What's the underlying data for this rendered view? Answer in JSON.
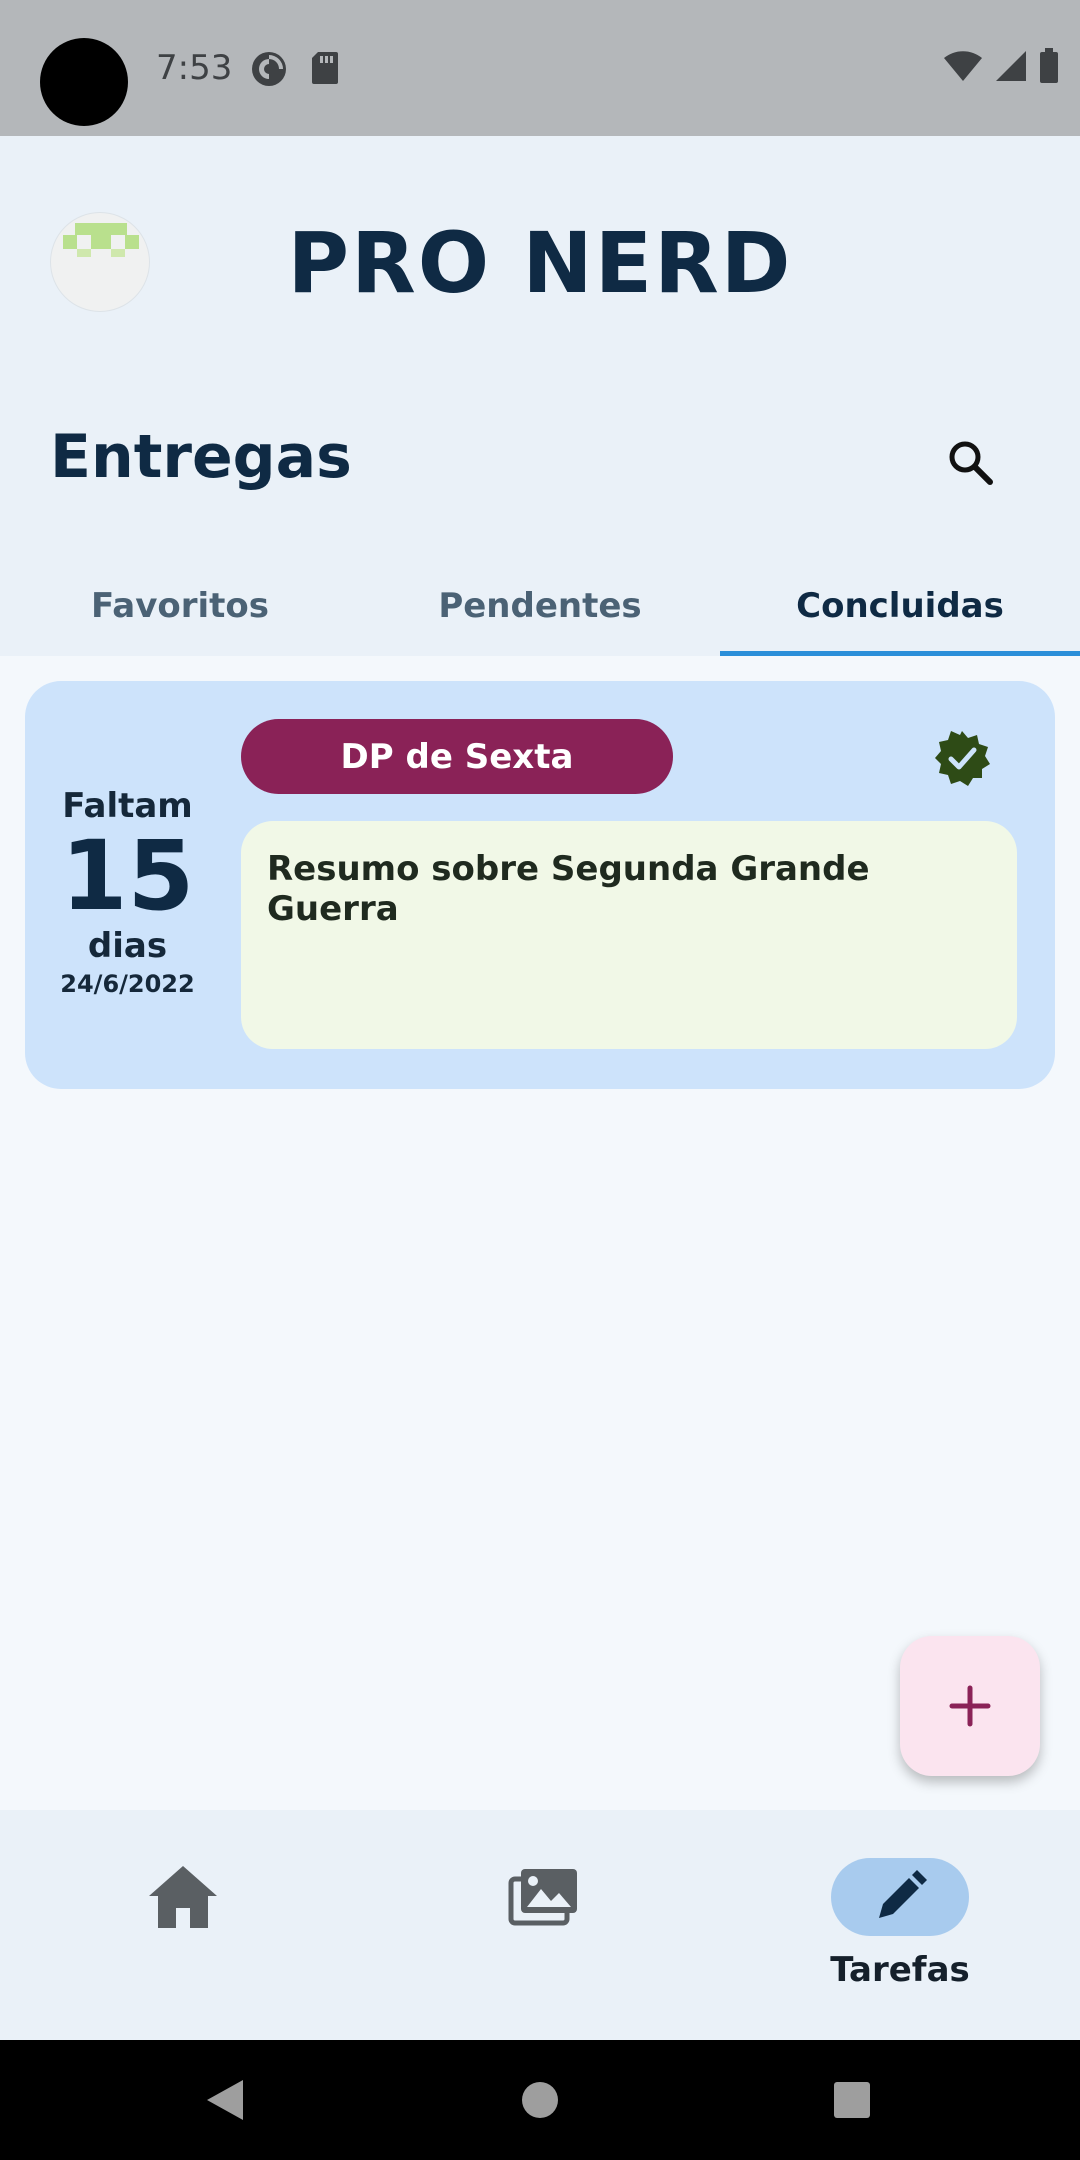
{
  "status_bar": {
    "time": "7:53",
    "left_icons": [
      "pocket-casts-icon",
      "sd-card-icon"
    ],
    "right_icons": [
      "wifi-icon",
      "cell-signal-icon",
      "battery-icon"
    ]
  },
  "header": {
    "app_title": "PRO NERD",
    "avatar_icon": "pixel-avatar-icon"
  },
  "section": {
    "title": "Entregas",
    "search_icon": "search-icon"
  },
  "tabs": [
    {
      "label": "Favoritos",
      "active": false
    },
    {
      "label": "Pendentes",
      "active": false
    },
    {
      "label": "Concluidas",
      "active": true
    }
  ],
  "task_card": {
    "remaining_prefix": "Faltam",
    "remaining_days": "15",
    "remaining_suffix": "dias",
    "due_date": "24/6/2022",
    "subject": "DP de Sexta",
    "subject_color": "#8a2257",
    "status_icon": "verified-check-icon",
    "status_color": "#2e4b16",
    "description": "Resumo sobre Segunda Grande Guerra"
  },
  "fab": {
    "icon": "plus-icon",
    "color": "#8a2257"
  },
  "bottom_nav": [
    {
      "icon": "home-icon",
      "label": "",
      "active": false
    },
    {
      "icon": "gallery-icon",
      "label": "",
      "active": false
    },
    {
      "icon": "pencil-icon",
      "label": "Tarefas",
      "active": true
    }
  ],
  "system_nav": [
    "back-icon",
    "home-circle-icon",
    "recents-icon"
  ],
  "colors": {
    "accent": "#2b8fd9",
    "title": "#0f2a44",
    "card_bg": "#cde3fb",
    "note_bg": "#f1f8e7"
  }
}
